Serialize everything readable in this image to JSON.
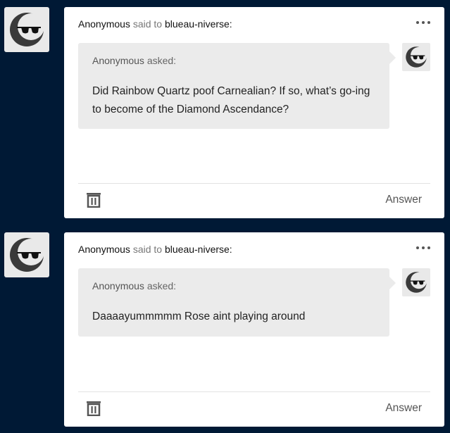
{
  "posts": [
    {
      "sender": "Anonymous",
      "verb": "said to",
      "recipient": "blueau-niverse:",
      "asker": "Anonymous",
      "asked_label": "asked:",
      "question": "Did Rainbow Quartz poof Carnealian? If so, what’s go-ing to become of the Diamond Ascendance?",
      "answer_label": "Answer"
    },
    {
      "sender": "Anonymous",
      "verb": "said to",
      "recipient": "blueau-niverse:",
      "asker": "Anonymous",
      "asked_label": "asked:",
      "question": "Daaaayummmmm Rose aint playing around",
      "answer_label": "Answer"
    }
  ],
  "icons": {
    "avatar": "anonymous-sunglasses-avatar",
    "more": "more-dots-icon",
    "delete": "trash-icon"
  },
  "colors": {
    "background": "#001935",
    "card": "#ffffff",
    "bubble": "#ebebeb"
  }
}
